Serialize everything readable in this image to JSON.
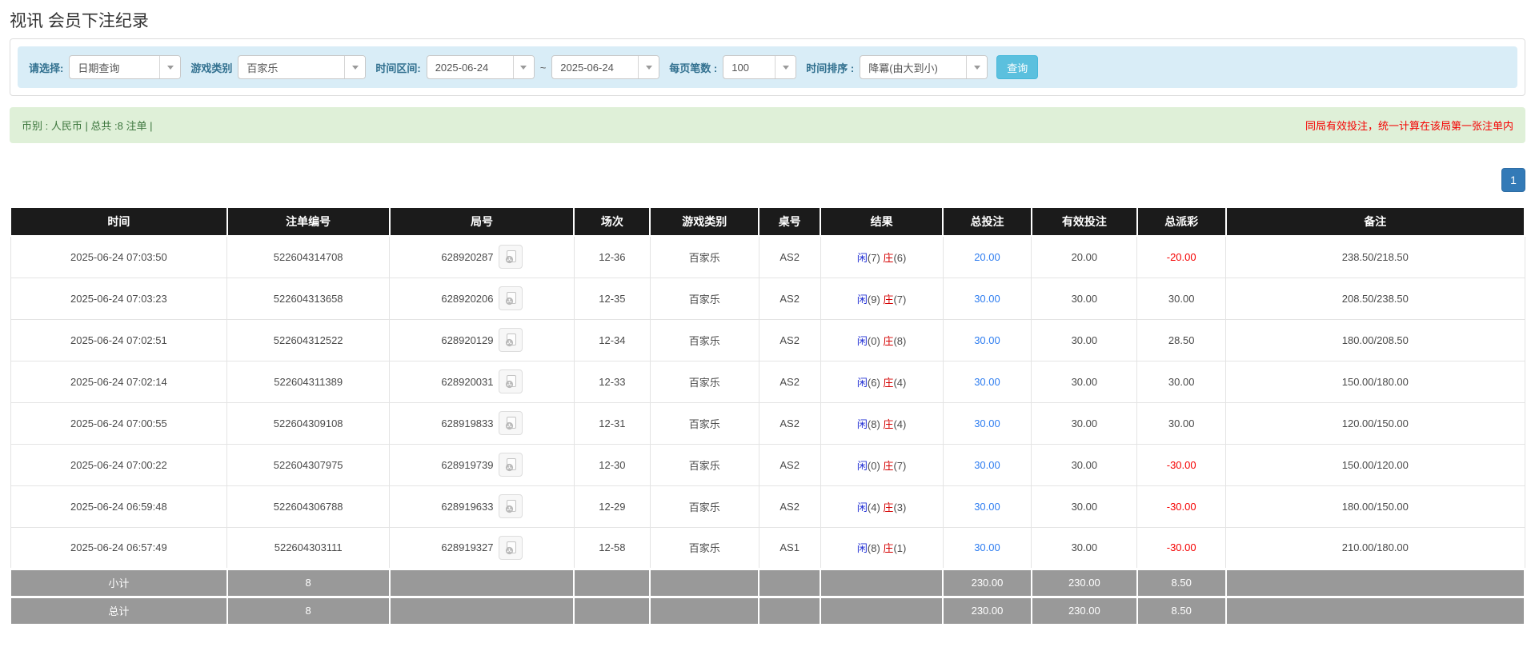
{
  "page": {
    "title": "视讯 会员下注纪录"
  },
  "filters": {
    "select_label": "请选择:",
    "select_value": "日期查询",
    "game_type_label": "游戏类别",
    "game_type_value": "百家乐",
    "time_range_label": "时间区间:",
    "date_from": "2025-06-24",
    "date_to": "2025-06-24",
    "range_separator": "~",
    "page_size_label": "每页笔数 :",
    "page_size_value": "100",
    "sort_label": "时间排序 :",
    "sort_value": "降冪(由大到小)",
    "search_button": "查询"
  },
  "summary": {
    "left": "币别 : 人民币 | 总共 :8 注单 |",
    "right": "同局有效投注，统一计算在该局第一张注单内"
  },
  "pagination": {
    "current": "1"
  },
  "colors": {
    "header_bg": "#1b1b1b",
    "filter_bg": "#d9edf7",
    "label_blue": "#31708f",
    "summary_bg": "#dff0d8",
    "summary_text": "#3c763d",
    "alert_red": "#f50000",
    "link_blue": "#2e7df0",
    "player_blue": "#2230d4",
    "banker_red": "#d40000",
    "negative_red": "#f50000",
    "footer_bg": "#999999",
    "search_btn_bg": "#5bc0de",
    "page_btn_bg": "#337ab7"
  },
  "table": {
    "headers": [
      "时间",
      "注单编号",
      "局号",
      "场次",
      "游戏类别",
      "桌号",
      "结果",
      "总投注",
      "有效投注",
      "总派彩",
      "备注"
    ],
    "rows": [
      {
        "time": "2025-06-24 07:03:50",
        "bet_id": "522604314708",
        "round_id": "628920287",
        "session": "12-36",
        "game": "百家乐",
        "table": "AS2",
        "player": "闲",
        "player_n": "(7)",
        "banker": "庄",
        "banker_n": "(6)",
        "total_bet": "20.00",
        "valid_bet": "20.00",
        "payout": "-20.00",
        "payout_negative": true,
        "remark": "238.50/218.50"
      },
      {
        "time": "2025-06-24 07:03:23",
        "bet_id": "522604313658",
        "round_id": "628920206",
        "session": "12-35",
        "game": "百家乐",
        "table": "AS2",
        "player": "闲",
        "player_n": "(9)",
        "banker": "庄",
        "banker_n": "(7)",
        "total_bet": "30.00",
        "valid_bet": "30.00",
        "payout": "30.00",
        "payout_negative": false,
        "remark": "208.50/238.50"
      },
      {
        "time": "2025-06-24 07:02:51",
        "bet_id": "522604312522",
        "round_id": "628920129",
        "session": "12-34",
        "game": "百家乐",
        "table": "AS2",
        "player": "闲",
        "player_n": "(0)",
        "banker": "庄",
        "banker_n": "(8)",
        "total_bet": "30.00",
        "valid_bet": "30.00",
        "payout": "28.50",
        "payout_negative": false,
        "remark": "180.00/208.50"
      },
      {
        "time": "2025-06-24 07:02:14",
        "bet_id": "522604311389",
        "round_id": "628920031",
        "session": "12-33",
        "game": "百家乐",
        "table": "AS2",
        "player": "闲",
        "player_n": "(6)",
        "banker": "庄",
        "banker_n": "(4)",
        "total_bet": "30.00",
        "valid_bet": "30.00",
        "payout": "30.00",
        "payout_negative": false,
        "remark": "150.00/180.00"
      },
      {
        "time": "2025-06-24 07:00:55",
        "bet_id": "522604309108",
        "round_id": "628919833",
        "session": "12-31",
        "game": "百家乐",
        "table": "AS2",
        "player": "闲",
        "player_n": "(8)",
        "banker": "庄",
        "banker_n": "(4)",
        "total_bet": "30.00",
        "valid_bet": "30.00",
        "payout": "30.00",
        "payout_negative": false,
        "remark": "120.00/150.00"
      },
      {
        "time": "2025-06-24 07:00:22",
        "bet_id": "522604307975",
        "round_id": "628919739",
        "session": "12-30",
        "game": "百家乐",
        "table": "AS2",
        "player": "闲",
        "player_n": "(0)",
        "banker": "庄",
        "banker_n": "(7)",
        "total_bet": "30.00",
        "valid_bet": "30.00",
        "payout": "-30.00",
        "payout_negative": true,
        "remark": "150.00/120.00"
      },
      {
        "time": "2025-06-24 06:59:48",
        "bet_id": "522604306788",
        "round_id": "628919633",
        "session": "12-29",
        "game": "百家乐",
        "table": "AS2",
        "player": "闲",
        "player_n": "(4)",
        "banker": "庄",
        "banker_n": "(3)",
        "total_bet": "30.00",
        "valid_bet": "30.00",
        "payout": "-30.00",
        "payout_negative": true,
        "remark": "180.00/150.00"
      },
      {
        "time": "2025-06-24 06:57:49",
        "bet_id": "522604303111",
        "round_id": "628919327",
        "session": "12-58",
        "game": "百家乐",
        "table": "AS1",
        "player": "闲",
        "player_n": "(8)",
        "banker": "庄",
        "banker_n": "(1)",
        "total_bet": "30.00",
        "valid_bet": "30.00",
        "payout": "-30.00",
        "payout_negative": true,
        "remark": "210.00/180.00"
      }
    ],
    "footer": [
      {
        "label": "小计",
        "count": "8",
        "total_bet": "230.00",
        "valid_bet": "230.00",
        "payout": "8.50"
      },
      {
        "label": "总计",
        "count": "8",
        "total_bet": "230.00",
        "valid_bet": "230.00",
        "payout": "8.50"
      }
    ]
  }
}
